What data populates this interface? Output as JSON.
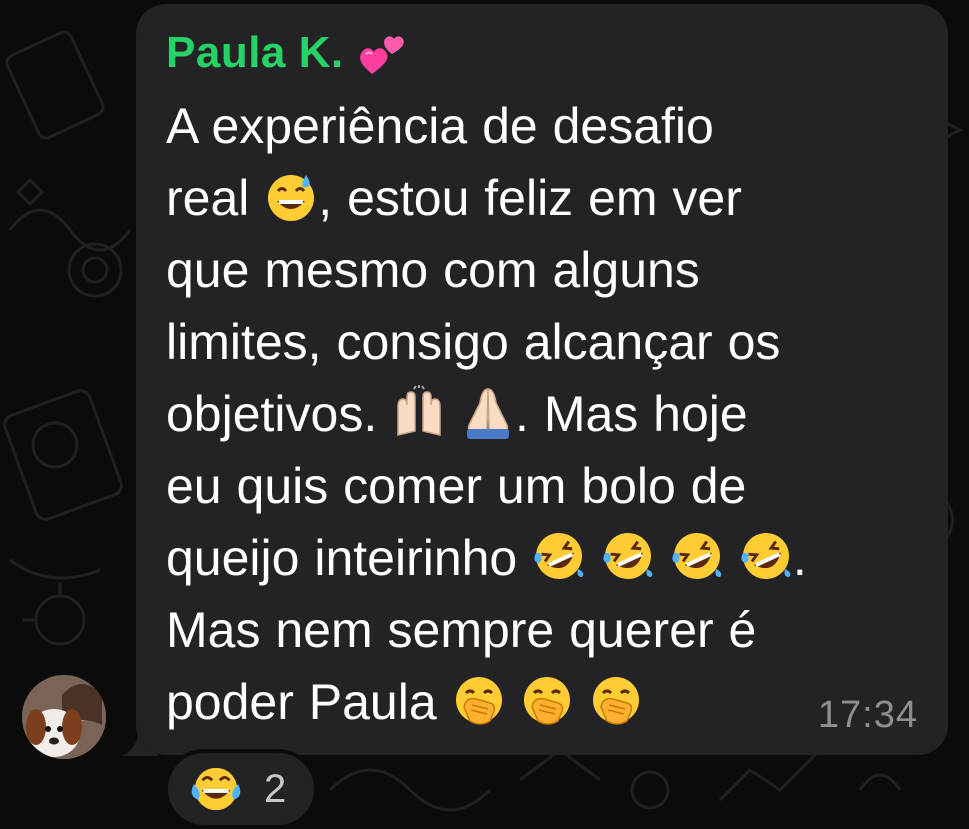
{
  "message": {
    "sender_name": "Paula K.",
    "sender_badge_icon": "two-hearts-icon",
    "sender_color": "#25d366",
    "lines": {
      "l1": "A experiência de desafio",
      "l2a": "real",
      "l2b": ", estou feliz em ver",
      "l3": "que mesmo com alguns",
      "l4": "limites, consigo alcançar os",
      "l5a": "objetivos.",
      "l5b": ". Mas hoje",
      "l6": "eu quis comer um bolo de",
      "l7a": "queijo inteirinho",
      "l7b": ".",
      "l8": "Mas nem sempre querer é",
      "l9a": "poder Paula"
    },
    "emojis": {
      "sweat_smile": "grinning-sweat-icon",
      "raised_hands": "raising-hands-icon",
      "folded_hands": "folded-hands-icon",
      "rofl": "rolling-on-floor-laughing-icon",
      "hand_over_mouth": "face-with-hand-over-mouth-icon"
    },
    "timestamp": "17:34"
  },
  "reaction": {
    "emoji": "face-with-tears-of-joy-icon",
    "count": "2"
  },
  "avatar": {
    "icon": "user-avatar-photo"
  }
}
